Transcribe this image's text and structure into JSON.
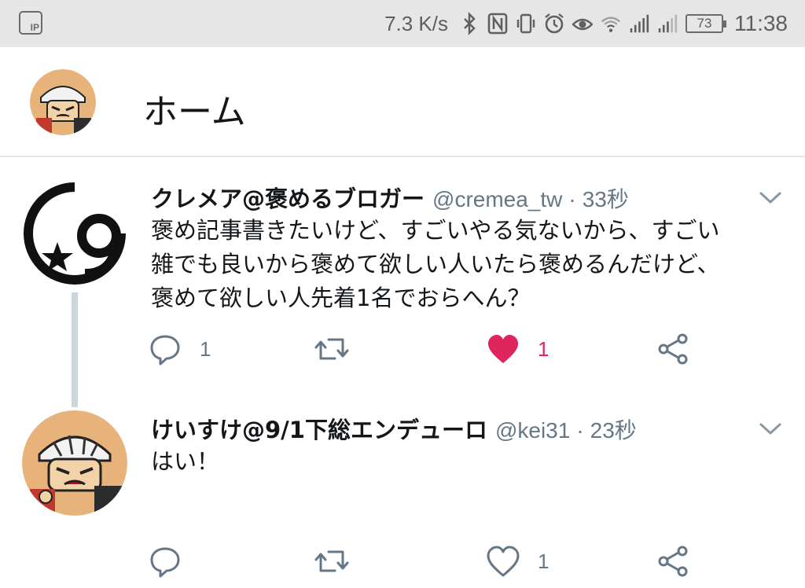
{
  "status_bar": {
    "ip_label": "IP",
    "network_speed": "7.3 K/s",
    "battery_level": "73",
    "time": "11:38",
    "icons": [
      "ip-icon",
      "bluetooth-icon",
      "nfc-icon",
      "vibrate-icon",
      "alarm-icon",
      "eye-icon",
      "wifi-icon",
      "signal-icon",
      "signal-icon-2",
      "battery-icon"
    ]
  },
  "header": {
    "title": "ホーム",
    "avatar_icon": "profile-avatar"
  },
  "tweets": [
    {
      "display_name": "クレメア@褒めるブロガー",
      "handle": "@cremea_tw",
      "separator": "·",
      "time": "33秒",
      "text": "褒め記事書きたいけど、すごいやる気ないから、すごい\n雑でも良いから褒めて欲しい人いたら褒めるんだけど、\n褒めて欲しい人先着1名でおらへん？",
      "reply_count": "1",
      "retweet_count": "",
      "like_count": "1",
      "liked": true
    },
    {
      "display_name": "けいすけ@9/1下総エンデューロ",
      "handle": "@kei31",
      "separator": "·",
      "time": "23秒",
      "text": "はい！",
      "reply_count": "",
      "retweet_count": "",
      "like_count": "1",
      "liked": false
    }
  ],
  "colors": {
    "status_bar_bg": "#e6e6e6",
    "text_primary": "#14171a",
    "text_secondary": "#657786",
    "like_active": "#e0245e",
    "thread_line": "#ccd6dd"
  }
}
